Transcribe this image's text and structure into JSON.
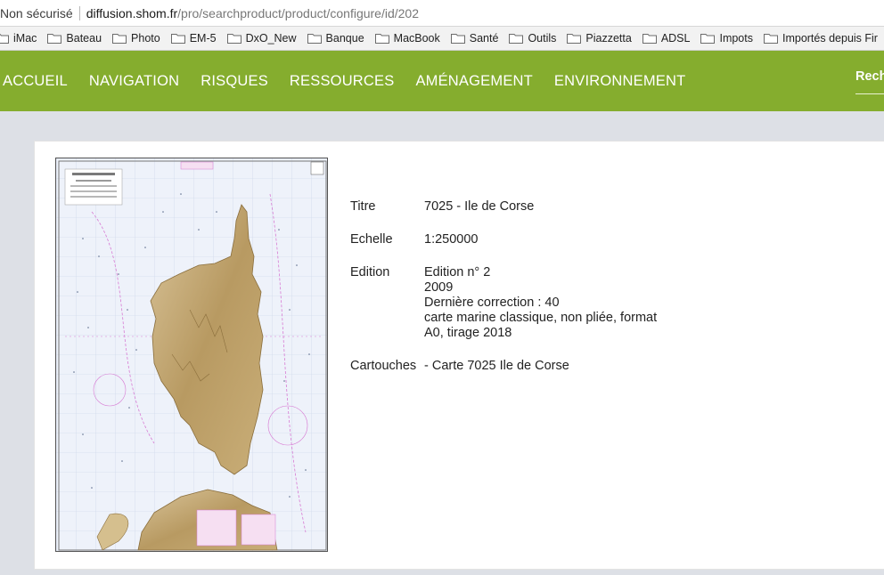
{
  "browser": {
    "security_label": "Non sécurisé",
    "url_host": "diffusion.shom.fr",
    "url_path": "/pro/searchproduct/product/configure/id/202"
  },
  "bookmarks": [
    {
      "label": "iMac",
      "icon": "folder-icon"
    },
    {
      "label": "Bateau",
      "icon": "folder-icon"
    },
    {
      "label": "Photo",
      "icon": "folder-icon"
    },
    {
      "label": "EM-5",
      "icon": "folder-icon"
    },
    {
      "label": "DxO_New",
      "icon": "folder-icon"
    },
    {
      "label": "Banque",
      "icon": "folder-icon"
    },
    {
      "label": "MacBook",
      "icon": "folder-icon"
    },
    {
      "label": "Santé",
      "icon": "folder-icon"
    },
    {
      "label": "Outils",
      "icon": "folder-icon"
    },
    {
      "label": "Piazzetta",
      "icon": "folder-icon"
    },
    {
      "label": "ADSL",
      "icon": "folder-icon"
    },
    {
      "label": "Impots",
      "icon": "folder-icon"
    },
    {
      "label": "Importés depuis Fir",
      "icon": "folder-icon"
    }
  ],
  "nav": {
    "items": [
      "ACCUEIL",
      "NAVIGATION",
      "RISQUES",
      "RESSOURCES",
      "AMÉNAGEMENT",
      "ENVIRONNEMENT"
    ],
    "search_label": "Rech",
    "color": "#85ad2e"
  },
  "product": {
    "image_icon": "nautical-chart-corsica",
    "fields": [
      {
        "label": "Titre",
        "lines": [
          "7025 - Ile de Corse"
        ]
      },
      {
        "label": "Echelle",
        "lines": [
          "1:250000"
        ]
      },
      {
        "label": "Edition",
        "lines": [
          "Edition n° 2",
          "2009",
          "Dernière correction : 40",
          "carte marine classique, non pliée, format",
          "A0, tirage 2018"
        ]
      },
      {
        "label": "Cartouches",
        "lines": [
          "- Carte 7025 Ile de Corse"
        ]
      }
    ]
  }
}
